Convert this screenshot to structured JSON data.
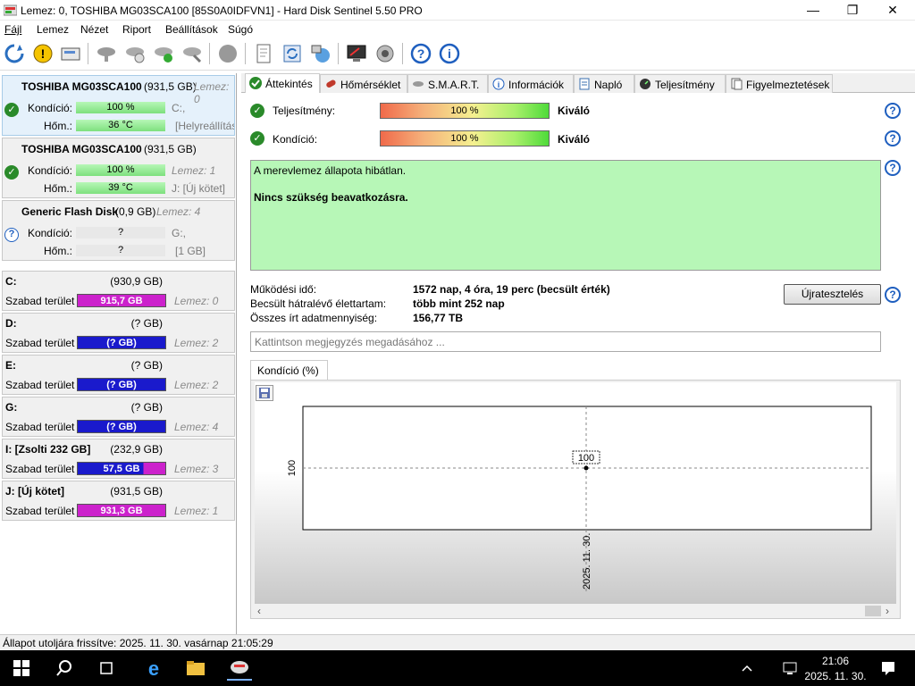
{
  "window": {
    "title": "Lemez: 0, TOSHIBA MG03SCA100 [85S0A0IDFVN1] - Hard Disk Sentinel 5.50 PRO",
    "minimize": "—",
    "maximize": "❐",
    "close": "✕"
  },
  "menu": [
    "Fájl",
    "Lemez",
    "Nézet",
    "Riport",
    "Beállítások",
    "Súgó"
  ],
  "disks": [
    {
      "name": "TOSHIBA MG03SCA100",
      "size": "(931,5 GB)",
      "lemez": "Lemez: 0",
      "cond_label": "Kondíció:",
      "cond": "100 %",
      "temp_label": "Hőm.:",
      "temp": "36 °C",
      "r1": "C:,",
      "r2": "[Helyreállítás",
      "status": "ok"
    },
    {
      "name": "TOSHIBA MG03SCA100",
      "size": "(931,5 GB)",
      "lemez": "",
      "cond_label": "Kondíció:",
      "cond": "100 %",
      "temp_label": "Hőm.:",
      "temp": "39 °C",
      "r1": "Lemez: 1",
      "r2": "J: [Új kötet]",
      "status": "ok"
    },
    {
      "name": "Generic Flash Disk",
      "size": "(0,9 GB)",
      "lemez": "Lemez: 4",
      "cond_label": "Kondíció:",
      "cond": "?",
      "temp_label": "Hőm.:",
      "temp": "?",
      "r1": "G:,",
      "r2": "[1 GB]",
      "status": "unknown"
    }
  ],
  "volumes": [
    {
      "name": "C:",
      "size": "(930,9 GB)",
      "free_label": "Szabad terület",
      "free": "915,7 GB",
      "lemez": "Lemez: 0",
      "color": "#cc22cc"
    },
    {
      "name": "D:",
      "size": "(? GB)",
      "free_label": "Szabad terület",
      "free": "(? GB)",
      "lemez": "Lemez: 2",
      "color": "#1a1acc"
    },
    {
      "name": "E:",
      "size": "(? GB)",
      "free_label": "Szabad terület",
      "free": "(? GB)",
      "lemez": "Lemez: 2",
      "color": "#1a1acc"
    },
    {
      "name": "G:",
      "size": "(? GB)",
      "free_label": "Szabad terület",
      "free": "(? GB)",
      "lemez": "Lemez: 4",
      "color": "#1a1acc"
    },
    {
      "name": "I: [Zsolti 232 GB]",
      "size": "(232,9 GB)",
      "free_label": "Szabad terület",
      "free": "57,5 GB",
      "lemez": "Lemez: 3",
      "color": "#1a1acc"
    },
    {
      "name": "J: [Új kötet]",
      "size": "(931,5 GB)",
      "free_label": "Szabad terület",
      "free": "931,3 GB",
      "lemez": "Lemez: 1",
      "color": "#cc22cc"
    }
  ],
  "tabs": [
    "Áttekintés",
    "Hőmérséklet",
    "S.M.A.R.T.",
    "Információk",
    "Napló",
    "Teljesítmény",
    "Figyelmeztetések"
  ],
  "overview": {
    "perf_label": "Teljesítmény:",
    "perf_value": "100 %",
    "perf_rating": "Kiváló",
    "cond_label": "Kondíció:",
    "cond_value": "100 %",
    "cond_rating": "Kiváló",
    "status_line1": "A merevlemez állapota hibátlan.",
    "status_line2": "Nincs szükség beavatkozásra.",
    "uptime_label": "Működési idő:",
    "uptime": "1572 nap, 4 óra, 19 perc (becsült érték)",
    "remaining_label": "Becsült hátralévő élettartam:",
    "remaining": "több mint 252 nap",
    "written_label": "Összes írt adatmennyiség:",
    "written": "156,77 TB",
    "retest": "Újratesztelés",
    "note_placeholder": "Kattintson megjegyzés megadásához ..."
  },
  "chart_tab": "Kondíció  (%)",
  "chart_data": {
    "type": "line",
    "x": [
      "2025. 11. 30."
    ],
    "series": [
      {
        "values": [
          100
        ]
      }
    ],
    "ylabel": "100",
    "data_label": "100",
    "grid": true
  },
  "statusbar": "Állapot utoljára frissítve: 2025. 11. 30. vasárnap 21:05:29",
  "taskbar": {
    "time": "21:06",
    "date": "2025. 11. 30."
  },
  "colors": {
    "ok_green": "#2a8a2a",
    "status_bg": "#b7f7b7",
    "help_blue": "#1f5fbf"
  }
}
